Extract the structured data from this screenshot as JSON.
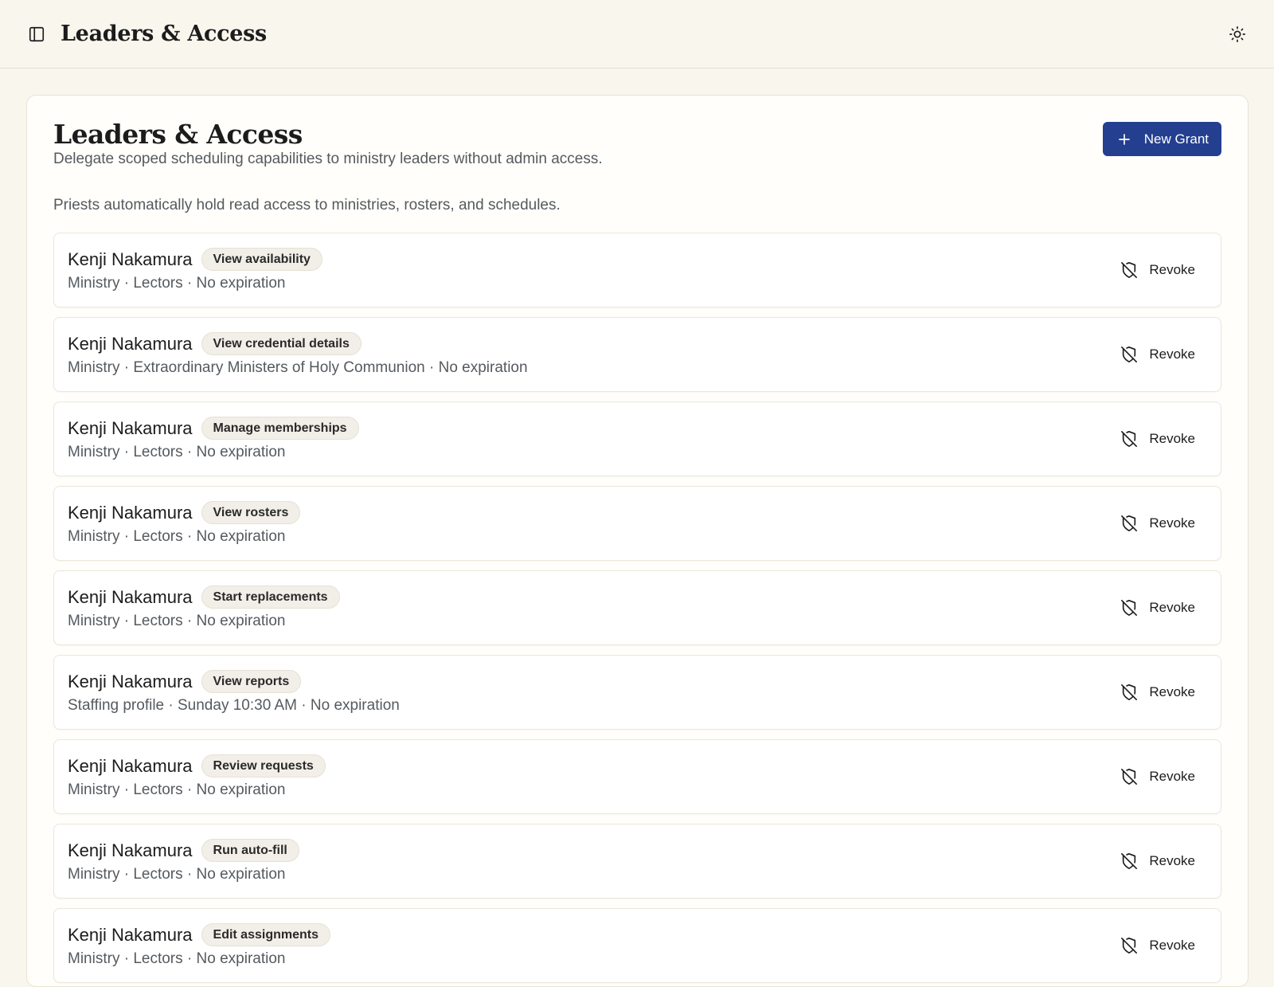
{
  "topbar": {
    "title": "Leaders & Access"
  },
  "header": {
    "title": "Leaders & Access",
    "subtitle": "Delegate scoped scheduling capabilities to ministry leaders without admin access.",
    "new_grant_label": "New Grant"
  },
  "note": "Priests automatically hold read access to ministries, rosters, and schedules.",
  "grants": [
    {
      "name": "Kenji Nakamura",
      "capability": "View availability",
      "meta": "Ministry · Lectors · No expiration",
      "action": "Revoke"
    },
    {
      "name": "Kenji Nakamura",
      "capability": "View credential details",
      "meta": "Ministry · Extraordinary Ministers of Holy Communion · No expiration",
      "action": "Revoke"
    },
    {
      "name": "Kenji Nakamura",
      "capability": "Manage memberships",
      "meta": "Ministry · Lectors · No expiration",
      "action": "Revoke"
    },
    {
      "name": "Kenji Nakamura",
      "capability": "View rosters",
      "meta": "Ministry · Lectors · No expiration",
      "action": "Revoke"
    },
    {
      "name": "Kenji Nakamura",
      "capability": "Start replacements",
      "meta": "Ministry · Lectors · No expiration",
      "action": "Revoke"
    },
    {
      "name": "Kenji Nakamura",
      "capability": "View reports",
      "meta": "Staffing profile · Sunday 10:30 AM · No expiration",
      "action": "Revoke"
    },
    {
      "name": "Kenji Nakamura",
      "capability": "Review requests",
      "meta": "Ministry · Lectors · No expiration",
      "action": "Revoke"
    },
    {
      "name": "Kenji Nakamura",
      "capability": "Run auto-fill",
      "meta": "Ministry · Lectors · No expiration",
      "action": "Revoke"
    },
    {
      "name": "Kenji Nakamura",
      "capability": "Edit assignments",
      "meta": "Ministry · Lectors · No expiration",
      "action": "Revoke"
    }
  ],
  "colors": {
    "background": "#f9f6ee",
    "primary": "#243f8f",
    "muted_text": "#555a5f"
  },
  "icons": {
    "sidebar_toggle": "sidebar-panel-icon",
    "theme_toggle": "sun-icon",
    "new_grant": "plus-icon",
    "revoke": "shield-off-icon"
  }
}
